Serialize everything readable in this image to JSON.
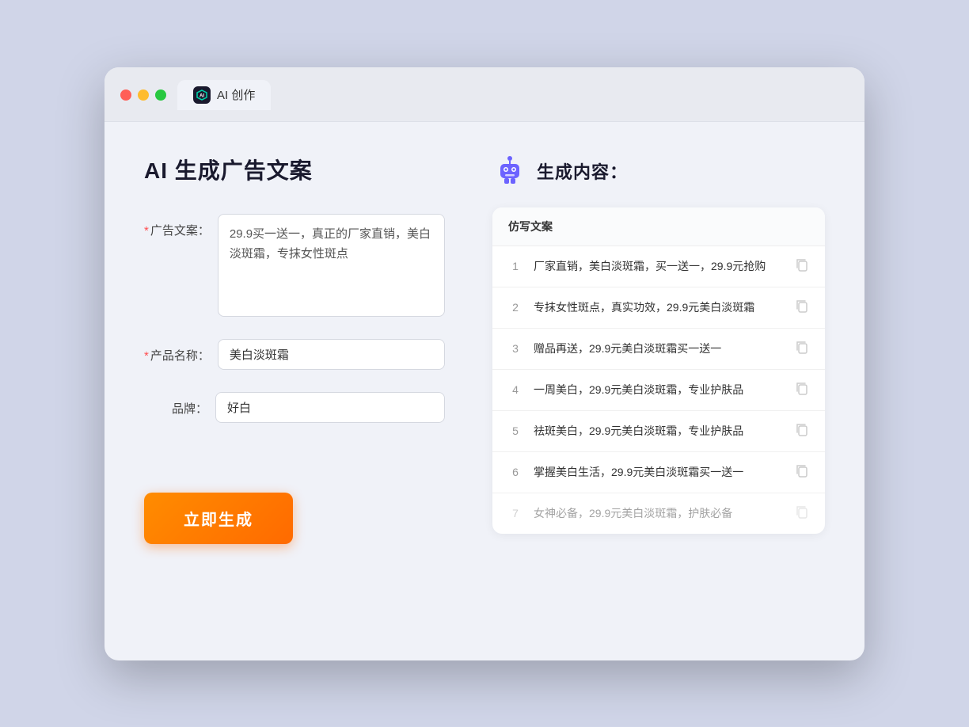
{
  "window": {
    "tab_label": "AI 创作"
  },
  "left": {
    "title": "AI 生成广告文案",
    "fields": [
      {
        "id": "ad_copy",
        "label": "广告文案：",
        "required": true,
        "type": "textarea",
        "value": "29.9买一送一，真正的厂家直销，美白淡斑霜，专抹女性斑点"
      },
      {
        "id": "product_name",
        "label": "产品名称：",
        "required": true,
        "type": "input",
        "value": "美白淡斑霜"
      },
      {
        "id": "brand",
        "label": "品牌：",
        "required": false,
        "type": "input",
        "value": "好白"
      }
    ],
    "generate_button": "立即生成"
  },
  "right": {
    "title": "生成内容：",
    "table_header": "仿写文案",
    "results": [
      {
        "number": "1",
        "text": "厂家直销，美白淡斑霜，买一送一，29.9元抢购",
        "dimmed": false
      },
      {
        "number": "2",
        "text": "专抹女性斑点，真实功效，29.9元美白淡斑霜",
        "dimmed": false
      },
      {
        "number": "3",
        "text": "赠品再送，29.9元美白淡斑霜买一送一",
        "dimmed": false
      },
      {
        "number": "4",
        "text": "一周美白，29.9元美白淡斑霜，专业护肤品",
        "dimmed": false
      },
      {
        "number": "5",
        "text": "祛斑美白，29.9元美白淡斑霜，专业护肤品",
        "dimmed": false
      },
      {
        "number": "6",
        "text": "掌握美白生活，29.9元美白淡斑霜买一送一",
        "dimmed": false
      },
      {
        "number": "7",
        "text": "女神必备，29.9元美白淡斑霜，护肤必备",
        "dimmed": true
      }
    ]
  }
}
